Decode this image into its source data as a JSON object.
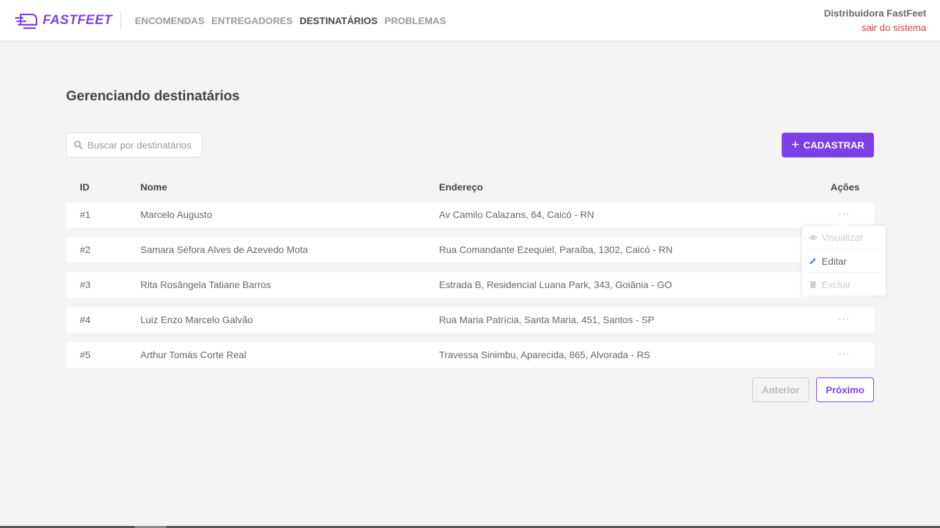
{
  "brand": {
    "name": "FASTFEET",
    "color": "#7d40e7"
  },
  "nav": [
    {
      "label": "ENCOMENDAS",
      "active": false
    },
    {
      "label": "ENTREGADORES",
      "active": false
    },
    {
      "label": "DESTINATÁRIOS",
      "active": true
    },
    {
      "label": "PROBLEMAS",
      "active": false
    }
  ],
  "user": {
    "name": "Distribuidora FastFeet",
    "logout_label": "sair do sistema"
  },
  "page": {
    "title": "Gerenciando destinatários"
  },
  "search": {
    "placeholder": "Buscar por destinatários",
    "value": ""
  },
  "add_button": {
    "label": "CADASTRAR",
    "icon": "plus-icon"
  },
  "table": {
    "headers": {
      "id": "ID",
      "name": "Nome",
      "address": "Endereço",
      "actions": "Ações"
    },
    "rows": [
      {
        "id": "#1",
        "name": "Marcelo Augusto",
        "address": "Av Camilo Calazans, 64, Caicó - RN"
      },
      {
        "id": "#2",
        "name": "Samara Séfora Alves de Azevedo Mota",
        "address": "Rua Comandante Ezequiel, Paraíba, 1302, Caicó - RN"
      },
      {
        "id": "#3",
        "name": "Rita Rosângela Tatiane Barros",
        "address": "Estrada B, Residencial Luana Park, 343, Goiânia - GO"
      },
      {
        "id": "#4",
        "name": "Luiz Enzo Marcelo Galvão",
        "address": "Rua Maria Patrícia, Santa Maria, 451, Santos - SP"
      },
      {
        "id": "#5",
        "name": "Arthur Tomás Corte Real",
        "address": "Travessa Sinimbu, Aparecida, 865, Alvorada - RS"
      }
    ],
    "actions_glyph": "···"
  },
  "actions_menu": {
    "items": [
      {
        "label": "Visualizar",
        "icon": "eye-icon",
        "enabled": false
      },
      {
        "label": "Editar",
        "icon": "pencil-icon",
        "enabled": true
      },
      {
        "label": "Excluir",
        "icon": "trash-icon",
        "enabled": false
      }
    ]
  },
  "pagination": {
    "prev_label": "Anterior",
    "next_label": "Próximo",
    "prev_enabled": false
  }
}
